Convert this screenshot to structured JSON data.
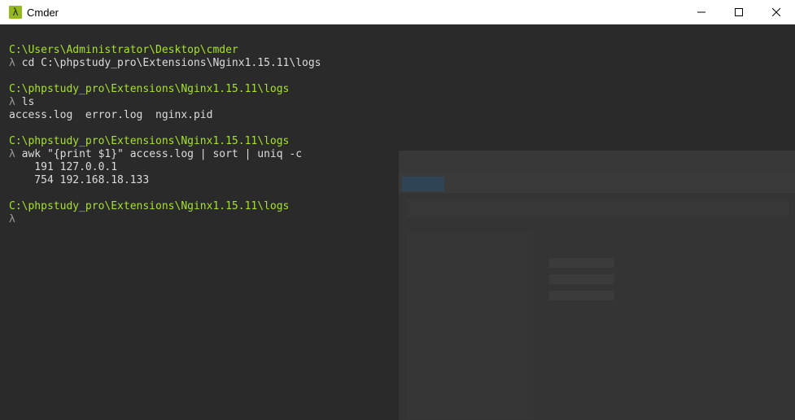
{
  "window": {
    "title": "Cmder",
    "icon": "lambda-icon",
    "icon_glyph": "λ"
  },
  "colors": {
    "path": "#a6e22e",
    "prompt": "#9b9b9b",
    "text": "#dcdcdc",
    "background": "#2a2a2a",
    "icon_bg": "#95b81f"
  },
  "terminal": {
    "lines": [
      {
        "type": "path",
        "text": "C:\\Users\\Administrator\\Desktop\\cmder"
      },
      {
        "type": "command",
        "prompt": "λ",
        "text": "cd C:\\phpstudy_pro\\Extensions\\Nginx1.15.11\\logs"
      },
      {
        "type": "blank",
        "text": ""
      },
      {
        "type": "path",
        "text": "C:\\phpstudy_pro\\Extensions\\Nginx1.15.11\\logs"
      },
      {
        "type": "command",
        "prompt": "λ",
        "text": "ls"
      },
      {
        "type": "output",
        "text": "access.log  error.log  nginx.pid"
      },
      {
        "type": "blank",
        "text": ""
      },
      {
        "type": "path",
        "text": "C:\\phpstudy_pro\\Extensions\\Nginx1.15.11\\logs"
      },
      {
        "type": "command",
        "prompt": "λ",
        "text": "awk \"{print $1}\" access.log | sort | uniq -c"
      },
      {
        "type": "output",
        "text": "    191 127.0.0.1"
      },
      {
        "type": "output",
        "text": "    754 192.168.18.133"
      },
      {
        "type": "blank",
        "text": ""
      },
      {
        "type": "path",
        "text": "C:\\phpstudy_pro\\Extensions\\Nginx1.15.11\\logs"
      },
      {
        "type": "command",
        "prompt": "λ",
        "text": ""
      }
    ]
  }
}
